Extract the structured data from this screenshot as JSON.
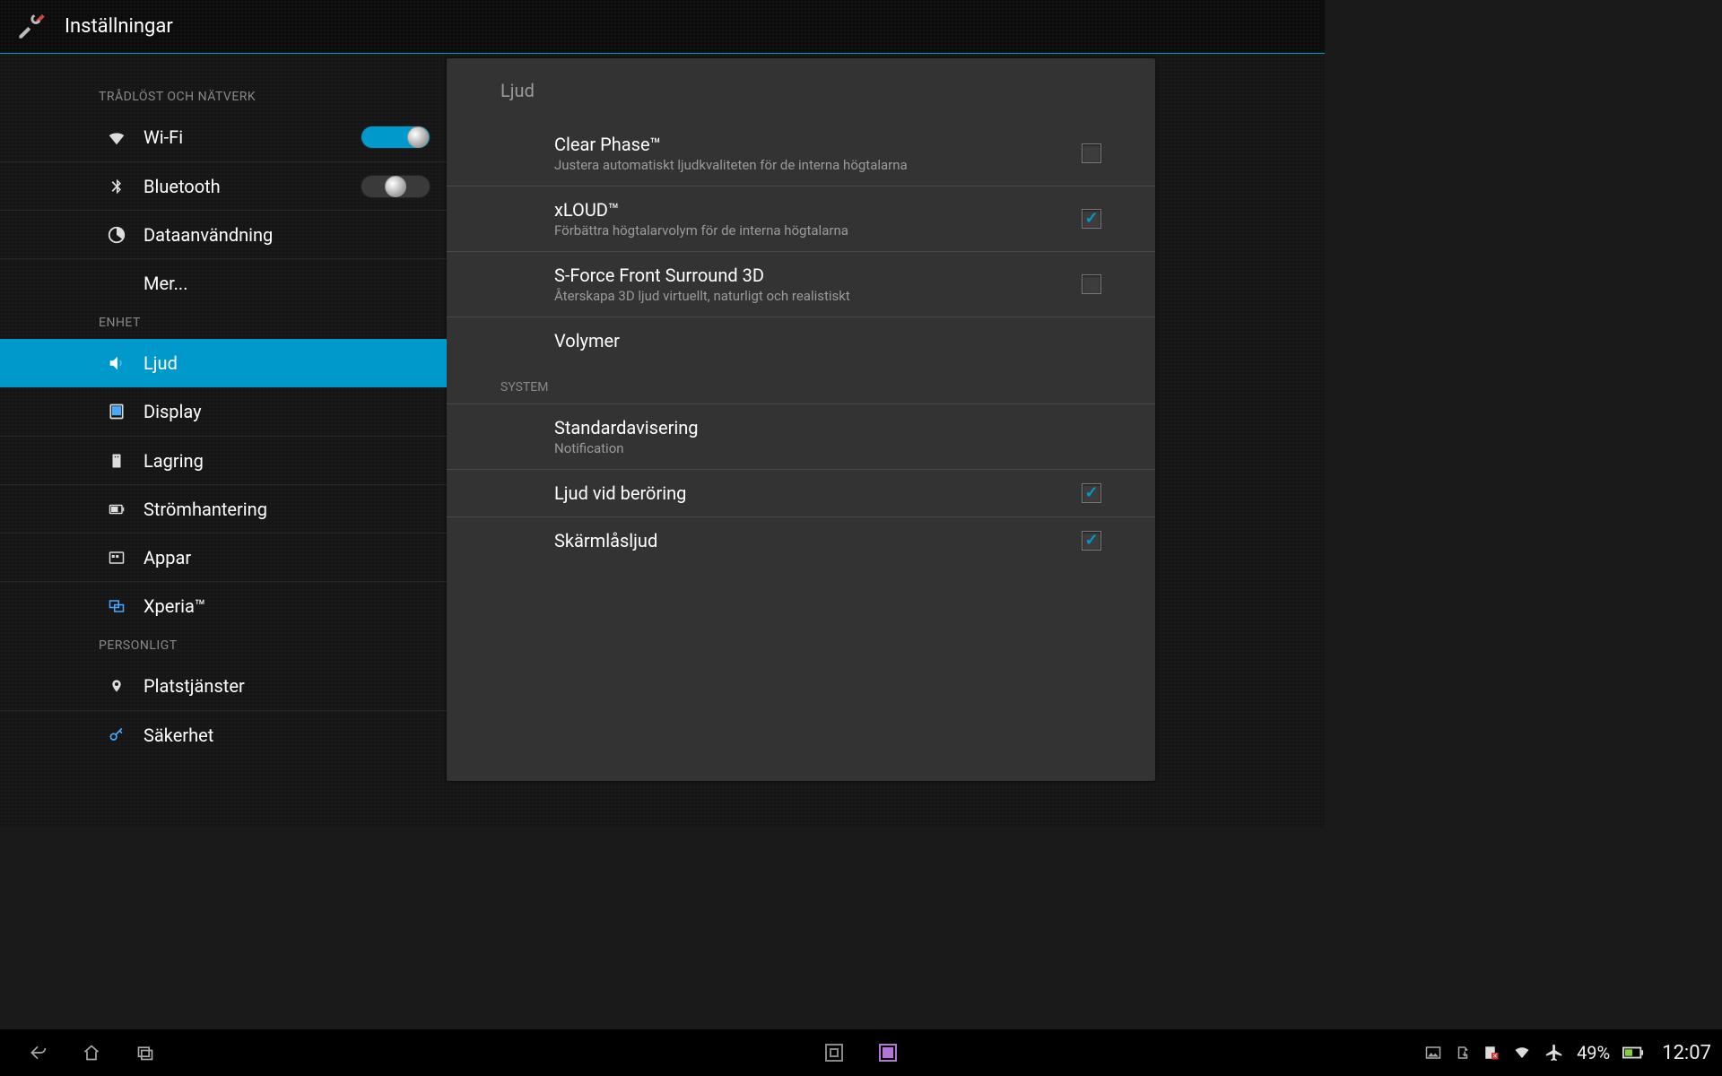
{
  "app": {
    "title": "Inställningar"
  },
  "sidebar": {
    "sections": {
      "wireless": "TRÅDLÖST OCH NÄTVERK",
      "device": "ENHET",
      "personal": "PERSONLIGT"
    },
    "items": {
      "wifi": {
        "label": "Wi-Fi",
        "toggle": true
      },
      "bluetooth": {
        "label": "Bluetooth",
        "toggle": false
      },
      "datausage": {
        "label": "Dataanvändning"
      },
      "more": {
        "label": "Mer..."
      },
      "sound": {
        "label": "Ljud",
        "selected": true
      },
      "display": {
        "label": "Display"
      },
      "storage": {
        "label": "Lagring"
      },
      "power": {
        "label": "Strömhantering"
      },
      "apps": {
        "label": "Appar"
      },
      "xperia": {
        "label": "Xperia™"
      },
      "location": {
        "label": "Platstjänster"
      },
      "security": {
        "label": "Säkerhet"
      }
    }
  },
  "panel": {
    "title": "Ljud",
    "clearphase": {
      "name": "Clear Phase™",
      "desc": "Justera automatiskt ljudkvaliteten för de interna högtalarna",
      "checked": false
    },
    "xloud": {
      "name": "xLOUD™",
      "desc": "Förbättra högtalarvolym för de interna högtalarna",
      "checked": true
    },
    "sforce": {
      "name": "S-Force Front Surround 3D",
      "desc": "Återskapa 3D ljud virtuellt, naturligt och realistiskt",
      "checked": false
    },
    "volumes": {
      "name": "Volymer"
    },
    "system_header": "SYSTEM",
    "default_notif": {
      "name": "Standardavisering",
      "desc": "Notification"
    },
    "touch_sounds": {
      "name": "Ljud vid beröring",
      "checked": true
    },
    "lock_sound": {
      "name": "Skärmlåsljud",
      "checked": true
    }
  },
  "navbar": {
    "battery_pct": "49%",
    "clock": "12:07"
  }
}
